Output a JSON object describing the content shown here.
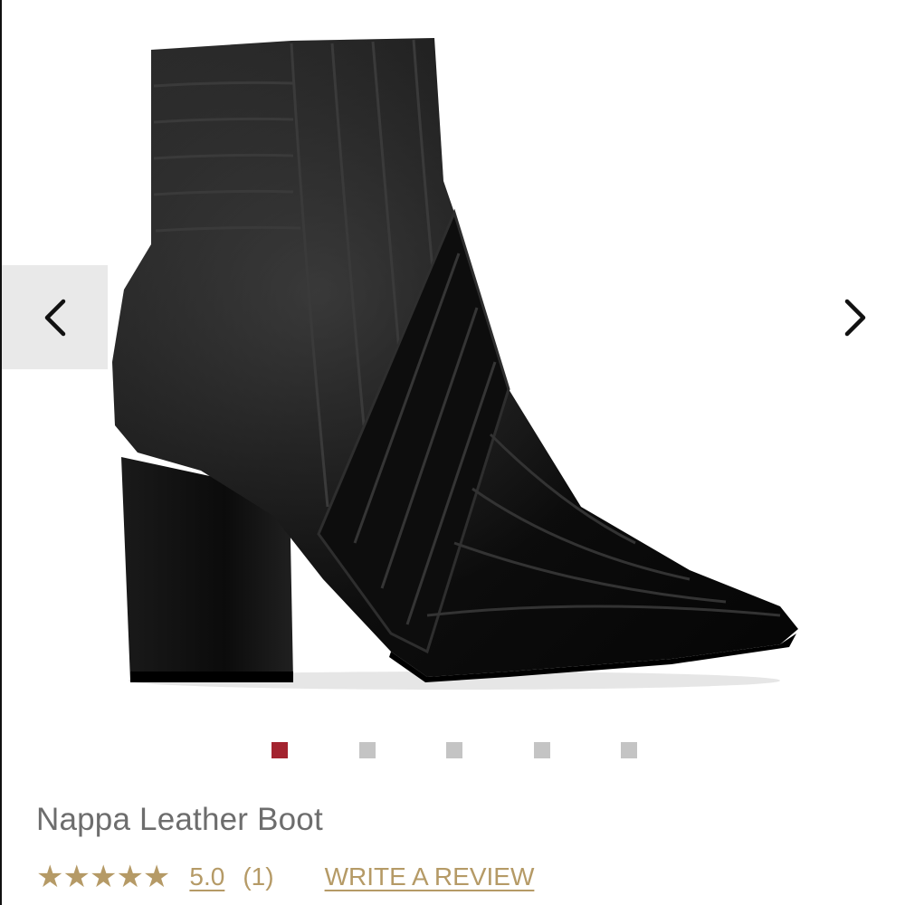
{
  "product": {
    "image_alt": "black quilted nappa leather ankle boot with block heel",
    "title": "Nappa Leather Boot"
  },
  "gallery": {
    "prev_icon": "chevron-left-icon",
    "next_icon": "chevron-right-icon",
    "active_index": 0,
    "dot_count": 5,
    "active_color": "#a3232f",
    "inactive_color": "#c4c4c4"
  },
  "rating": {
    "stars": "★★★★★",
    "star_count": 5,
    "value": "5.0",
    "count": "(1)",
    "write_review": "WRITE A REVIEW",
    "accent_color": "#b59a66"
  }
}
